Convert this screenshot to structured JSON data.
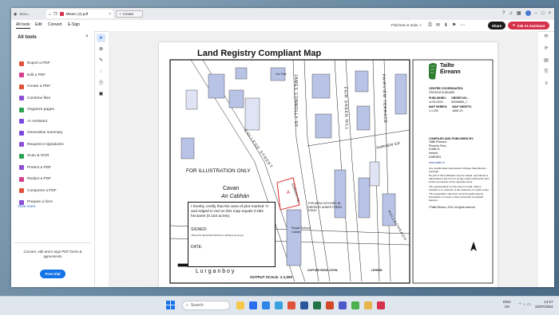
{
  "browser": {
    "tabs": [
      {
        "label": "Mitiam Clinter Dublin Rd Site",
        "sub": "Secu..."
      },
      {
        "label": "Mitiam (2).pdf"
      }
    ],
    "new_tab_label": "Create"
  },
  "menubar": {
    "items": [
      "All tools",
      "Edit",
      "Convert",
      "E-Sign"
    ],
    "find_label": "Find text or tools",
    "share_label": "Share",
    "ai_label": "Ask AI Assistant"
  },
  "tools_panel": {
    "title": "All tools",
    "items": [
      {
        "label": "Export a PDF",
        "color": "#e0533b"
      },
      {
        "label": "Edit a PDF",
        "color": "#d63f8c"
      },
      {
        "label": "Create a PDF",
        "color": "#e0533b"
      },
      {
        "label": "Combine files",
        "color": "#8c4fd6"
      },
      {
        "label": "Organize pages",
        "color": "#2aa353"
      },
      {
        "label": "AI Assistant",
        "color": "#7a4ae0"
      },
      {
        "label": "Generative summary",
        "color": "#7a4ae0"
      },
      {
        "label": "Request e-signatures",
        "color": "#8c4fd6"
      },
      {
        "label": "Scan & OCR",
        "color": "#2aa353"
      },
      {
        "label": "Protect a PDF",
        "color": "#8c4fd6"
      },
      {
        "label": "Redact a PDF",
        "color": "#d63f8c"
      },
      {
        "label": "Compress a PDF",
        "color": "#e0533b"
      },
      {
        "label": "Prepare a form",
        "color": "#8c4fd6"
      }
    ],
    "view_more": "View more",
    "promo_text": "Convert, edit and e-sign PDF forms & agreements",
    "trial_label": "Free trial"
  },
  "document": {
    "title": "Land Registry Compliant Map",
    "brand_line1": "Tailte",
    "brand_line2": "Éireann",
    "illustration": "FOR ILLUSTRATION ONLY",
    "place1": "Cavan",
    "place2": "An Cabhán",
    "certify": "I hereby certify that the area of plot marked 'A' and edged in red on this map equals 0.062 hectares (0.154 acres).",
    "signed": "SIGNED:",
    "date": "DATE:",
    "surveyor": "JARLATH GRAHAM DIPLB.Sc. Building Surveyor",
    "lurganboy": "L u r g a n b o y",
    "output_scale": "OUTPUT SCALE: 1:1,000",
    "area_note": "THIS AREA OUTLINED IN GREEN IS UNDER FRESH TODAY",
    "school": "Royal School Cavan",
    "street_labels": [
      "COLLEGE STREET",
      "JAMES CONNOLLY ST",
      "FAIR GREEN HILL",
      "FAIRVIEW TERRACE",
      "FAIRVIEW ICE",
      "PULLAGHRAGH",
      "GORDON RD",
      "Car Park"
    ],
    "plot_label": "A",
    "info": {
      "centre_label": "CENTRE COORDINATES:",
      "centre_value": "ITM 641213,804483",
      "published_label": "PUBLISHED:",
      "published_value": "11/01/2024",
      "order_label": "ORDER NO.:",
      "order_value": "50058885_1",
      "map_series_label": "MAP SERIES:",
      "map_series_value": "1:1,000",
      "map_sheets_label": "MAP SHEETS:",
      "map_sheets_value": "1660-23",
      "compiled": "COMPILED AND PUBLISHED BY:",
      "compiled_lines": [
        "Tailte Éireann,",
        "Phoenix Park,",
        "Dublin 8,",
        "Ireland,",
        "D08F6E4"
      ],
      "website": "www.tailte.ie",
      "notes": [
        "Any unauthorised reproduction infringes Tailte Éireann copyright.",
        "No part of this publication may be copied, reproduced or transmitted in any form or by any means without the prior written permission of the copyright owner.",
        "The representation on this map of a road, track or footpath is no evidence of the existence of a right of way.",
        "This topographic map does not show legal property boundaries, nor does it show ownership of physical features."
      ],
      "copyright": "©Tailte Éireann, 2024. All rights reserved."
    },
    "capture_label": "CAPTURE RESOLUTION:",
    "legend_label": "LEGEND:"
  },
  "taskbar": {
    "search_placeholder": "Search",
    "lang1": "ENG",
    "lang2": "US",
    "time": "14:27",
    "date": "22/07/2024"
  }
}
